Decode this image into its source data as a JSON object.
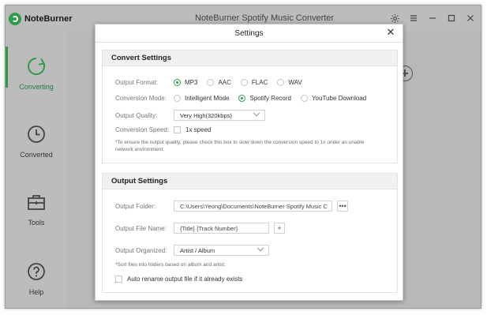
{
  "app": {
    "brand_name": "NoteBurner",
    "title": "NoteBurner Spotify Music Converter"
  },
  "sidebar": {
    "items": [
      {
        "label": "Converting",
        "icon": "converting-icon",
        "active": true
      },
      {
        "label": "Converted",
        "icon": "clock-icon",
        "active": false
      },
      {
        "label": "Tools",
        "icon": "toolbox-icon",
        "active": false
      },
      {
        "label": "Help",
        "icon": "help-icon",
        "active": false
      }
    ]
  },
  "dialog": {
    "title": "Settings",
    "convert": {
      "heading": "Convert Settings",
      "format_label": "Output Format:",
      "formats": [
        "MP3",
        "AAC",
        "FLAC",
        "WAV"
      ],
      "selected_format": "MP3",
      "mode_label": "Conversion Mode:",
      "modes": [
        "Intelligent Mode",
        "Spotify Record",
        "YouTube Download"
      ],
      "selected_mode": "Spotify Record",
      "quality_label": "Output Quality:",
      "quality_value": "Very High(320kbps)",
      "speed_label": "Conversion Speed:",
      "speed_option": "1x speed",
      "speed_note": "*To ensure the output quality, please check this box to slow down the conversion speed to 1x under an unable network environment."
    },
    "output": {
      "heading": "Output Settings",
      "folder_label": "Output Folder:",
      "folder_value": "C:\\Users\\Yeong\\Documents\\NoteBurner Spotify Music C",
      "browse_label": "•••",
      "filename_label": "Output File Name:",
      "filename_value": "{Title} {Track Number}",
      "add_label": "+",
      "organized_label": "Output Organized:",
      "organized_value": "Artist / Album",
      "organized_note": "*Sort files into folders based on album and artist.",
      "rename_label": "Auto rename output file if it already exists"
    }
  },
  "colors": {
    "accent": "#2f9b4a",
    "sidebar_bg": "#bcbcbc"
  }
}
